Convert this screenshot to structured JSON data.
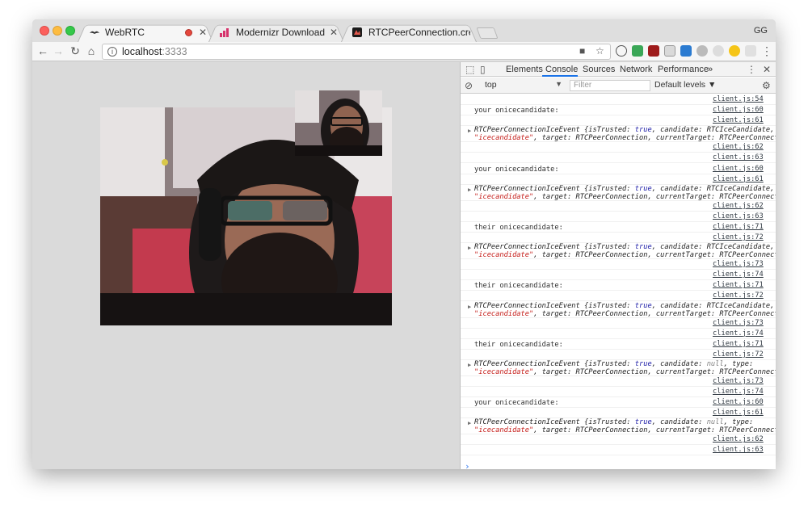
{
  "browser": {
    "tabs": [
      {
        "title": "WebRTC",
        "recording": true
      },
      {
        "title": "Modernizr Download Builder",
        "recording": false
      },
      {
        "title": "RTCPeerConnection.createOff",
        "recording": false
      }
    ],
    "profile": "GG",
    "url_host": "localhost",
    "url_port": ":3333"
  },
  "devtools": {
    "tabs": [
      "Elements",
      "Console",
      "Sources",
      "Network",
      "Performance"
    ],
    "more": "»",
    "active_tab": "Console",
    "context": "top",
    "filter_placeholder": "Filter",
    "levels": "Default levels ▼"
  },
  "console": {
    "entries": [
      {
        "kind": "src",
        "src": "client.js:54"
      },
      {
        "kind": "log",
        "text": "your onicecandidate:",
        "src": "client.js:60"
      },
      {
        "kind": "src",
        "src": "client.js:61"
      },
      {
        "kind": "obj",
        "candidate": "RTCIceCandidate",
        "target": "RTCPeerConnection",
        "current": "RTCPeerConnection,"
      },
      {
        "kind": "src",
        "src": "client.js:62"
      },
      {
        "kind": "src",
        "src": "client.js:63"
      },
      {
        "kind": "log",
        "text": "your onicecandidate:",
        "src": "client.js:60"
      },
      {
        "kind": "src",
        "src": "client.js:61"
      },
      {
        "kind": "obj",
        "candidate": "RTCIceCandidate",
        "target": "RTCPeerConnection",
        "current": "RTCPeerConnection,"
      },
      {
        "kind": "src",
        "src": "client.js:62"
      },
      {
        "kind": "src",
        "src": "client.js:63"
      },
      {
        "kind": "log",
        "text": "their onicecandidate:",
        "src": "client.js:71"
      },
      {
        "kind": "src",
        "src": "client.js:72"
      },
      {
        "kind": "obj",
        "candidate": "RTCIceCandidate",
        "target": "RTCPeerConnection",
        "current": "RTCPeerConnection,"
      },
      {
        "kind": "src",
        "src": "client.js:73"
      },
      {
        "kind": "src",
        "src": "client.js:74"
      },
      {
        "kind": "log",
        "text": "their onicecandidate:",
        "src": "client.js:71"
      },
      {
        "kind": "src",
        "src": "client.js:72"
      },
      {
        "kind": "obj",
        "candidate": "RTCIceCandidate",
        "target": "RTCPeerConnection",
        "current": "RTCPeerConnection,"
      },
      {
        "kind": "src",
        "src": "client.js:73"
      },
      {
        "kind": "src",
        "src": "client.js:74"
      },
      {
        "kind": "log",
        "text": "their onicecandidate:",
        "src": "client.js:71"
      },
      {
        "kind": "src",
        "src": "client.js:72"
      },
      {
        "kind": "obj",
        "candidate": "null",
        "target": "RTCPeerConnection",
        "current": "RTCPeerConnection,"
      },
      {
        "kind": "src",
        "src": "client.js:73"
      },
      {
        "kind": "src",
        "src": "client.js:74"
      },
      {
        "kind": "log",
        "text": "your onicecandidate:",
        "src": "client.js:60"
      },
      {
        "kind": "src",
        "src": "client.js:61"
      },
      {
        "kind": "obj",
        "candidate": "null",
        "target": "RTCPeerConnection",
        "current": "RTCPeerConnection,"
      },
      {
        "kind": "src",
        "src": "client.js:62"
      },
      {
        "kind": "src",
        "src": "client.js:63"
      }
    ],
    "prompt": "›"
  }
}
